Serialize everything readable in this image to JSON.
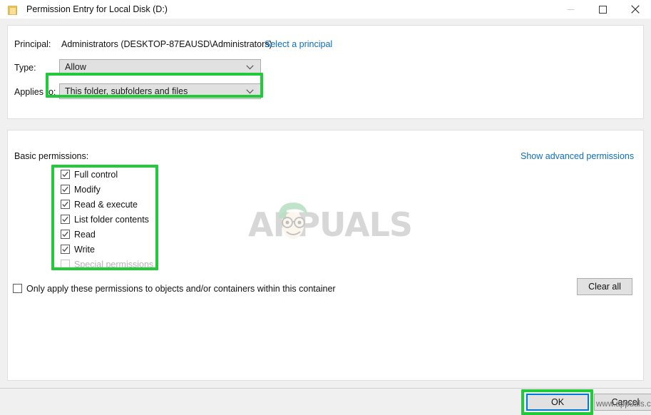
{
  "window": {
    "title": "Permission Entry for Local Disk (D:)",
    "icon": "folder-icon",
    "controls": {
      "minimize": "minimize-icon",
      "maximize": "maximize-icon",
      "close": "close-icon"
    }
  },
  "principal_section": {
    "principal_label": "Principal:",
    "principal_value": "Administrators (DESKTOP-87EAUSD\\Administrators)",
    "select_principal_link": "Select a principal",
    "type_label": "Type:",
    "type_value": "Allow",
    "applies_to_label": "Applies to:",
    "applies_to_value": "This folder, subfolders and files"
  },
  "permissions_section": {
    "heading": "Basic permissions:",
    "show_advanced_link": "Show advanced permissions",
    "items": [
      {
        "label": "Full control",
        "checked": true,
        "disabled": false
      },
      {
        "label": "Modify",
        "checked": true,
        "disabled": false
      },
      {
        "label": "Read & execute",
        "checked": true,
        "disabled": false
      },
      {
        "label": "List folder contents",
        "checked": true,
        "disabled": false
      },
      {
        "label": "Read",
        "checked": true,
        "disabled": false
      },
      {
        "label": "Write",
        "checked": true,
        "disabled": false
      },
      {
        "label": "Special permissions",
        "checked": false,
        "disabled": true
      }
    ],
    "only_apply_label": "Only apply these permissions to objects and/or containers within this container",
    "only_apply_checked": false,
    "clear_all_label": "Clear all"
  },
  "footer": {
    "ok_label": "OK",
    "cancel_label": "Cancel"
  },
  "watermark": {
    "brand": "APPUALS",
    "url": "www.appuals.com"
  },
  "highlight_color": "#22c93a",
  "focus_color": "#0078d7",
  "link_color": "#0a6fc2"
}
